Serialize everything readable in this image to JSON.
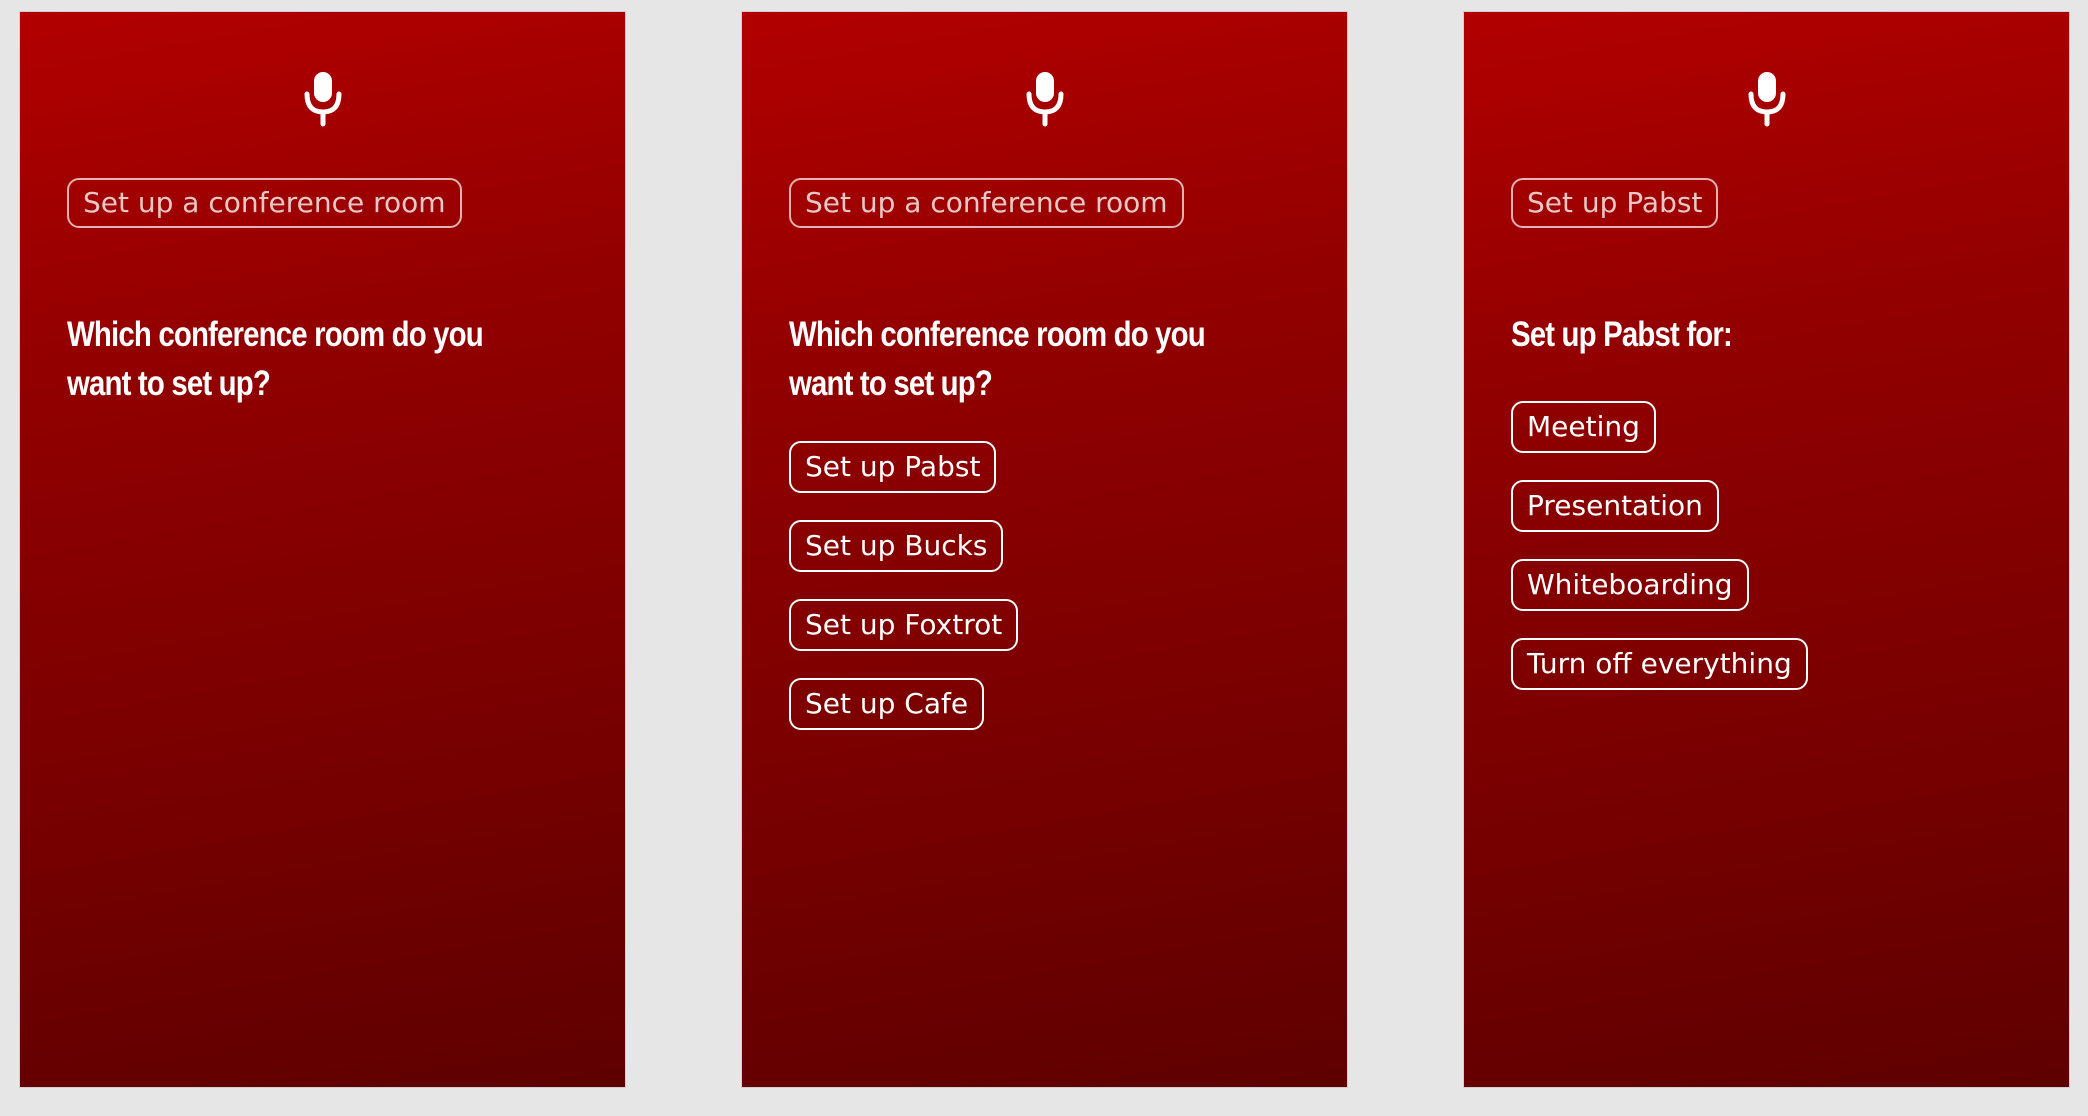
{
  "screens": [
    {
      "query": "Set up a conference room",
      "heading": "Which conference room do you want to set up?",
      "options": []
    },
    {
      "query": "Set up a conference room",
      "heading": "Which conference room do you want to set up?",
      "options": [
        "Set up Pabst",
        "Set up Bucks",
        "Set up Foxtrot",
        "Set up Cafe"
      ]
    },
    {
      "query": "Set up Pabst",
      "heading": "Set up Pabst for:",
      "options": [
        "Meeting",
        "Presentation",
        "Whiteboarding",
        "Turn off everything"
      ]
    }
  ],
  "icons": {
    "microphone": "microphone-icon"
  },
  "colors": {
    "background": "#e6e6e6",
    "gradient_top": "#b20000",
    "gradient_bottom": "#5e0000",
    "text": "#ffffff"
  }
}
